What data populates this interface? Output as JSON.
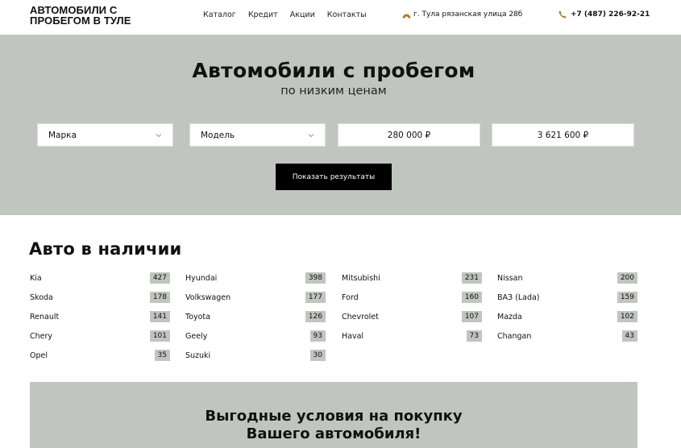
{
  "header": {
    "logo_line1": "АВТОМОБИЛИ С",
    "logo_line2": "ПРОБЕГОМ В ТУЛЕ",
    "nav": [
      "Каталог",
      "Кредит",
      "Акции",
      "Контакты"
    ],
    "address": "г. Тула рязанская улица 28б",
    "phone": "+7 (487) 226-92-21",
    "accent_color": "#b07a2e"
  },
  "hero": {
    "title": "Автомобили с пробегом",
    "subtitle": "по низким ценам",
    "brand_select": "Марка",
    "model_select": "Модель",
    "price_from": "280 000 ₽",
    "price_to": "3 621 600 ₽",
    "submit": "Показать результаты",
    "background_color": "#c0c6bf"
  },
  "brands": {
    "title": "Авто в наличии",
    "columns": [
      [
        {
          "name": "Kia",
          "count": "427"
        },
        {
          "name": "Skoda",
          "count": "178"
        },
        {
          "name": "Renault",
          "count": "141"
        },
        {
          "name": "Chery",
          "count": "101"
        },
        {
          "name": "Opel",
          "count": "35"
        }
      ],
      [
        {
          "name": "Hyundai",
          "count": "398"
        },
        {
          "name": "Volkswagen",
          "count": "177"
        },
        {
          "name": "Toyota",
          "count": "126"
        },
        {
          "name": "Geely",
          "count": "93"
        },
        {
          "name": "Suzuki",
          "count": "30"
        }
      ],
      [
        {
          "name": "Mitsubishi",
          "count": "231"
        },
        {
          "name": "Ford",
          "count": "160"
        },
        {
          "name": "Chevrolet",
          "count": "107"
        },
        {
          "name": "Haval",
          "count": "73"
        }
      ],
      [
        {
          "name": "Nissan",
          "count": "200"
        },
        {
          "name": "ВАЗ (Lada)",
          "count": "159"
        },
        {
          "name": "Mazda",
          "count": "102"
        },
        {
          "name": "Changan",
          "count": "43"
        }
      ]
    ]
  },
  "promo": {
    "line1": "Выгодные условия на покупку",
    "line2": "Вашего автомобиля!"
  }
}
